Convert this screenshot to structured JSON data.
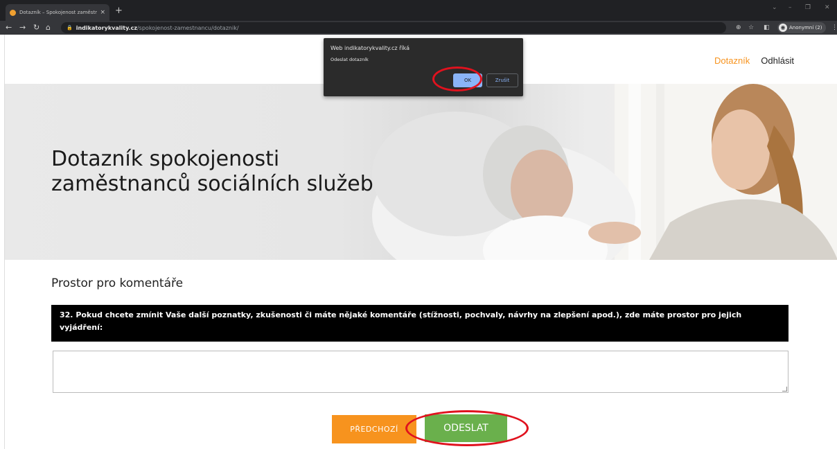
{
  "browser": {
    "tab_title": "Dotazník – Spokojenost zaměstn",
    "tab_close": "×",
    "new_tab": "+",
    "url_host": "indikatorykvality.cz",
    "url_path": "/spokojenost-zamestnancu/dotaznik/",
    "profile_label": "Anonymní (2)"
  },
  "site_nav": {
    "items": [
      {
        "label": "Dotazník",
        "active": true
      },
      {
        "label": "Odhlásit",
        "active": false
      }
    ],
    "accent_color": "#f7931e"
  },
  "hero": {
    "title_line1": "Dotazník spokojenosti",
    "title_line2": "zaměstnanců sociálních služeb"
  },
  "form": {
    "section_heading": "Prostor pro komentáře",
    "question_text": "32. Pokud chcete zmínit Vaše další poznatky, zkušenosti či máte nějaké komentáře (stížnosti, pochvaly, návrhy na zlepšení apod.), zde máte prostor pro jejich vyjádření:",
    "comment_value": "",
    "prev_button": "PŘEDCHOZÍ",
    "send_button": "ODESLAT",
    "prev_color": "#f7931e",
    "send_color": "#6ab04c"
  },
  "dialog": {
    "title": "Web indikatorykvality.cz říká",
    "message": "Odeslat dotazník",
    "ok_label": "OK",
    "cancel_label": "Zrušit"
  },
  "icons": [
    "back-icon",
    "forward-icon",
    "reload-icon",
    "home-icon",
    "lock-icon",
    "zoom-icon",
    "star-icon",
    "sidepanel-icon",
    "incognito-icon",
    "menu-icon"
  ],
  "annotation_color": "#e0121e"
}
